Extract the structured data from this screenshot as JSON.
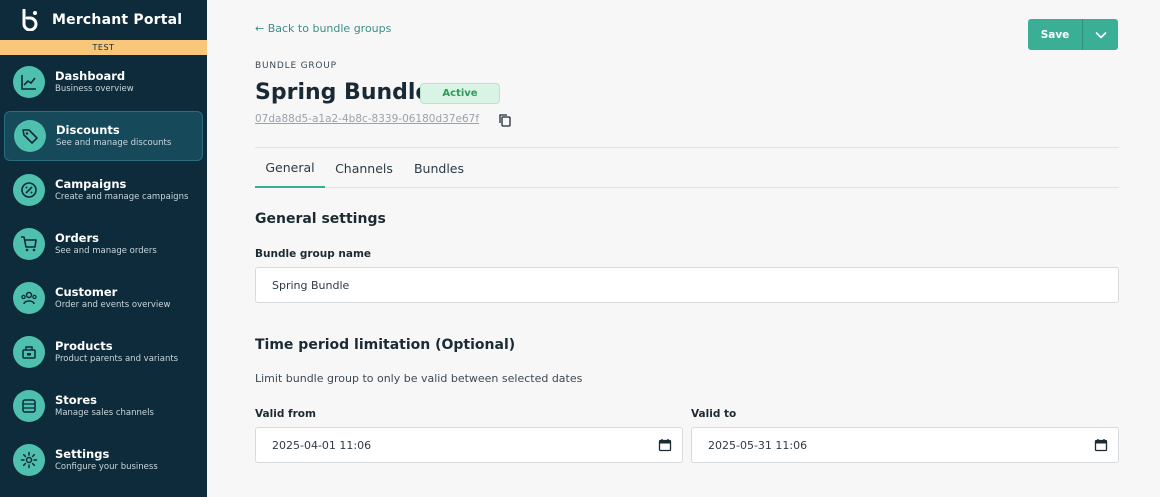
{
  "brand": {
    "title": "Merchant Portal",
    "env": "TEST"
  },
  "sidebar": {
    "items": [
      {
        "label": "Dashboard",
        "sub": "Business overview",
        "icon": "chart-line-icon"
      },
      {
        "label": "Discounts",
        "sub": "See and manage discounts",
        "icon": "tag-icon"
      },
      {
        "label": "Campaigns",
        "sub": "Create and manage campaigns",
        "icon": "campaign-icon"
      },
      {
        "label": "Orders",
        "sub": "See and manage orders",
        "icon": "cart-icon"
      },
      {
        "label": "Customer",
        "sub": "Order and events overview",
        "icon": "users-icon"
      },
      {
        "label": "Products",
        "sub": "Product parents and variants",
        "icon": "product-icon"
      },
      {
        "label": "Stores",
        "sub": "Manage sales channels",
        "icon": "store-icon"
      },
      {
        "label": "Settings",
        "sub": "Configure your business",
        "icon": "gear-icon"
      }
    ],
    "active_index": 1
  },
  "header": {
    "back_label": "Back to bundle groups",
    "overline": "BUNDLE GROUP",
    "title": "Spring Bundle",
    "status": "Active",
    "uuid": "07da88d5-a1a2-4b8c-8339-06180d37e67f",
    "save_label": "Save"
  },
  "tabs": [
    {
      "label": "General"
    },
    {
      "label": "Channels"
    },
    {
      "label": "Bundles"
    }
  ],
  "general": {
    "section_title": "General settings",
    "name_label": "Bundle group name",
    "name_value": "Spring Bundle"
  },
  "time_period": {
    "section_title": "Time period limitation (Optional)",
    "description": "Limit bundle group to only be valid between selected dates",
    "valid_from_label": "Valid from",
    "valid_from_value": "2025-04-01 11:06",
    "valid_to_label": "Valid to",
    "valid_to_value": "2025-05-31 11:06"
  },
  "colors": {
    "sidebar_bg": "#0d2b3a",
    "accent": "#3aaf96",
    "icon_circle": "#4fc0ad",
    "env_badge": "#f9c77a",
    "status_green": "#2d9b58"
  }
}
